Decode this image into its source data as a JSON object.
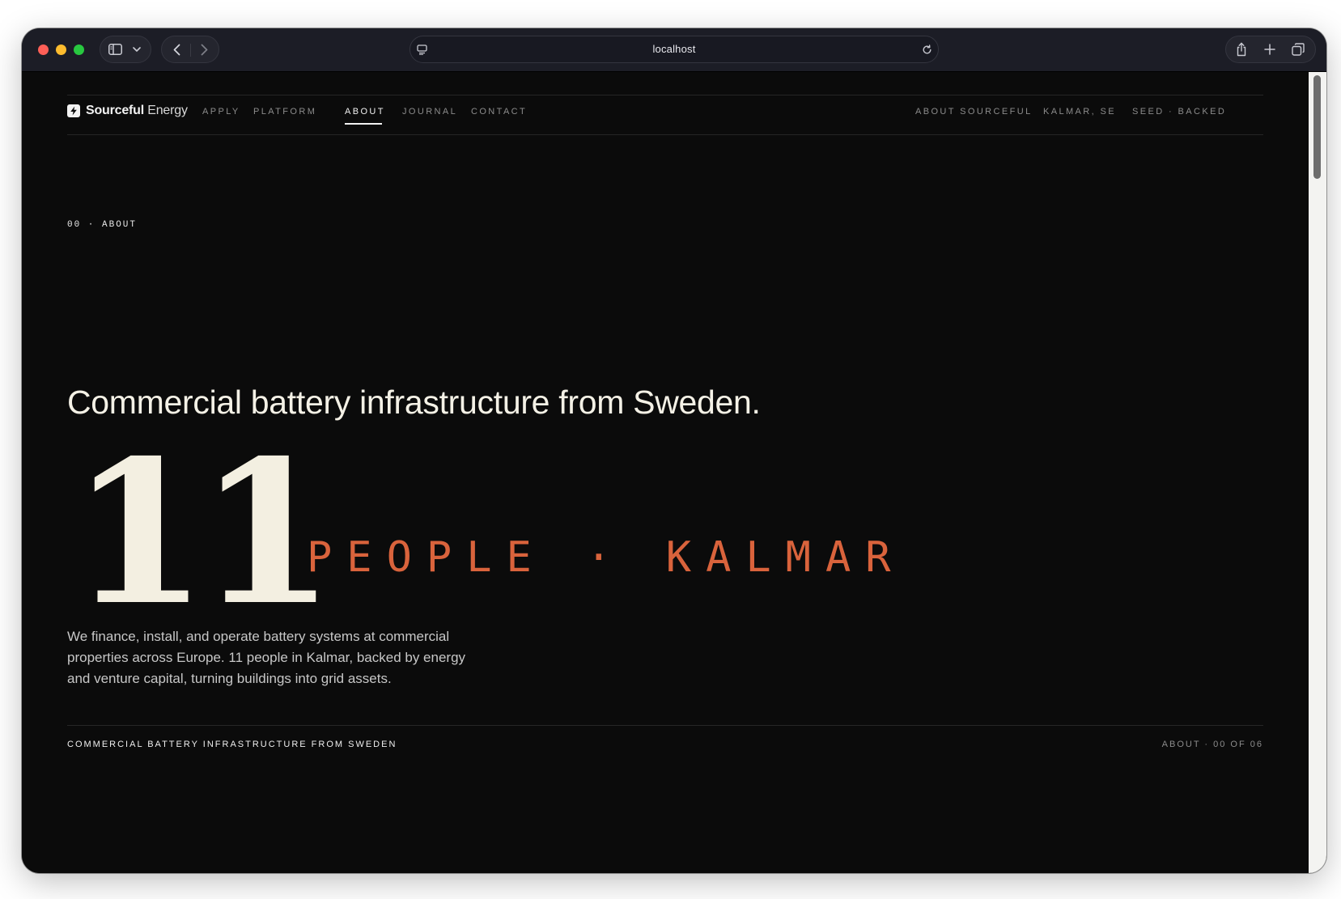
{
  "browser": {
    "url": "localhost",
    "icons": {
      "sidebar": "sidebar-icon",
      "chevron": "chevron-down-icon",
      "back": "back-arrow-icon",
      "forward": "forward-arrow-icon",
      "page_info": "page-info-icon",
      "reload": "reload-icon",
      "share": "share-icon",
      "new_tab": "plus-icon",
      "tabs": "tabs-overview-icon"
    }
  },
  "nav": {
    "brand_bold": "Sourceful",
    "brand_light": "Energy",
    "items": [
      {
        "label": "APPLY"
      },
      {
        "label": "PLATFORM"
      },
      {
        "label": "ABOUT",
        "active": true
      },
      {
        "label": "JOURNAL"
      },
      {
        "label": "CONTACT"
      }
    ],
    "right": [
      {
        "label": "ABOUT SOURCEFUL"
      },
      {
        "label": "KALMAR, SE"
      },
      {
        "label": "SEED · BACKED"
      }
    ]
  },
  "hero": {
    "section_label": "00 · ABOUT",
    "headline": "Commercial battery infrastructure from Sweden.",
    "big_number": "11",
    "big_sub": "PEOPLE · KALMAR",
    "body": "We finance, install, and operate battery systems at commercial properties across Europe. 11 people in Kalmar, backed by energy and venture capital, turning buildings into grid assets."
  },
  "footer": {
    "left": "COMMERCIAL BATTERY INFRASTRUCTURE FROM SWEDEN",
    "right": "ABOUT · 00 OF 06"
  },
  "colors": {
    "page_bg": "#0b0b0b",
    "accent": "#d9633c",
    "cream": "#f3efe1"
  }
}
